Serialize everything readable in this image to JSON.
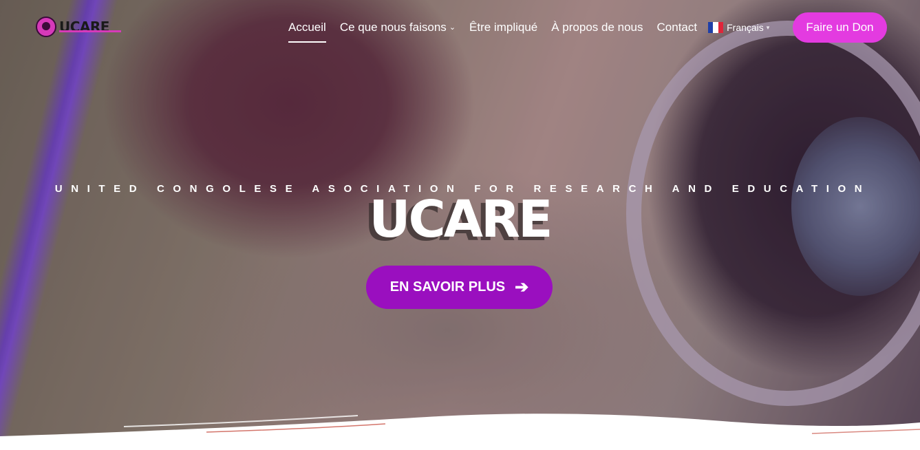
{
  "brand": {
    "logo_text": "UCARE"
  },
  "nav": {
    "items": [
      {
        "label": "Accueil"
      },
      {
        "label": "Ce que nous faisons"
      },
      {
        "label": "Être impliqué"
      },
      {
        "label": "À propos de nous"
      },
      {
        "label": "Contact"
      }
    ],
    "language": "Français",
    "donate_label": "Faire un Don"
  },
  "hero": {
    "tagline": "UNITED CONGOLESE ASOCIATION FOR RESEARCH AND EDUCATION",
    "title": "UCARE",
    "cta_label": "EN SAVOIR PLUS"
  },
  "colors": {
    "accent": "#e33be0",
    "cta": "#9a0fbf"
  },
  "icons": {
    "dropdown": "chevron-down-icon",
    "flag": "france-flag-icon",
    "cta": "arrow-right-icon"
  }
}
